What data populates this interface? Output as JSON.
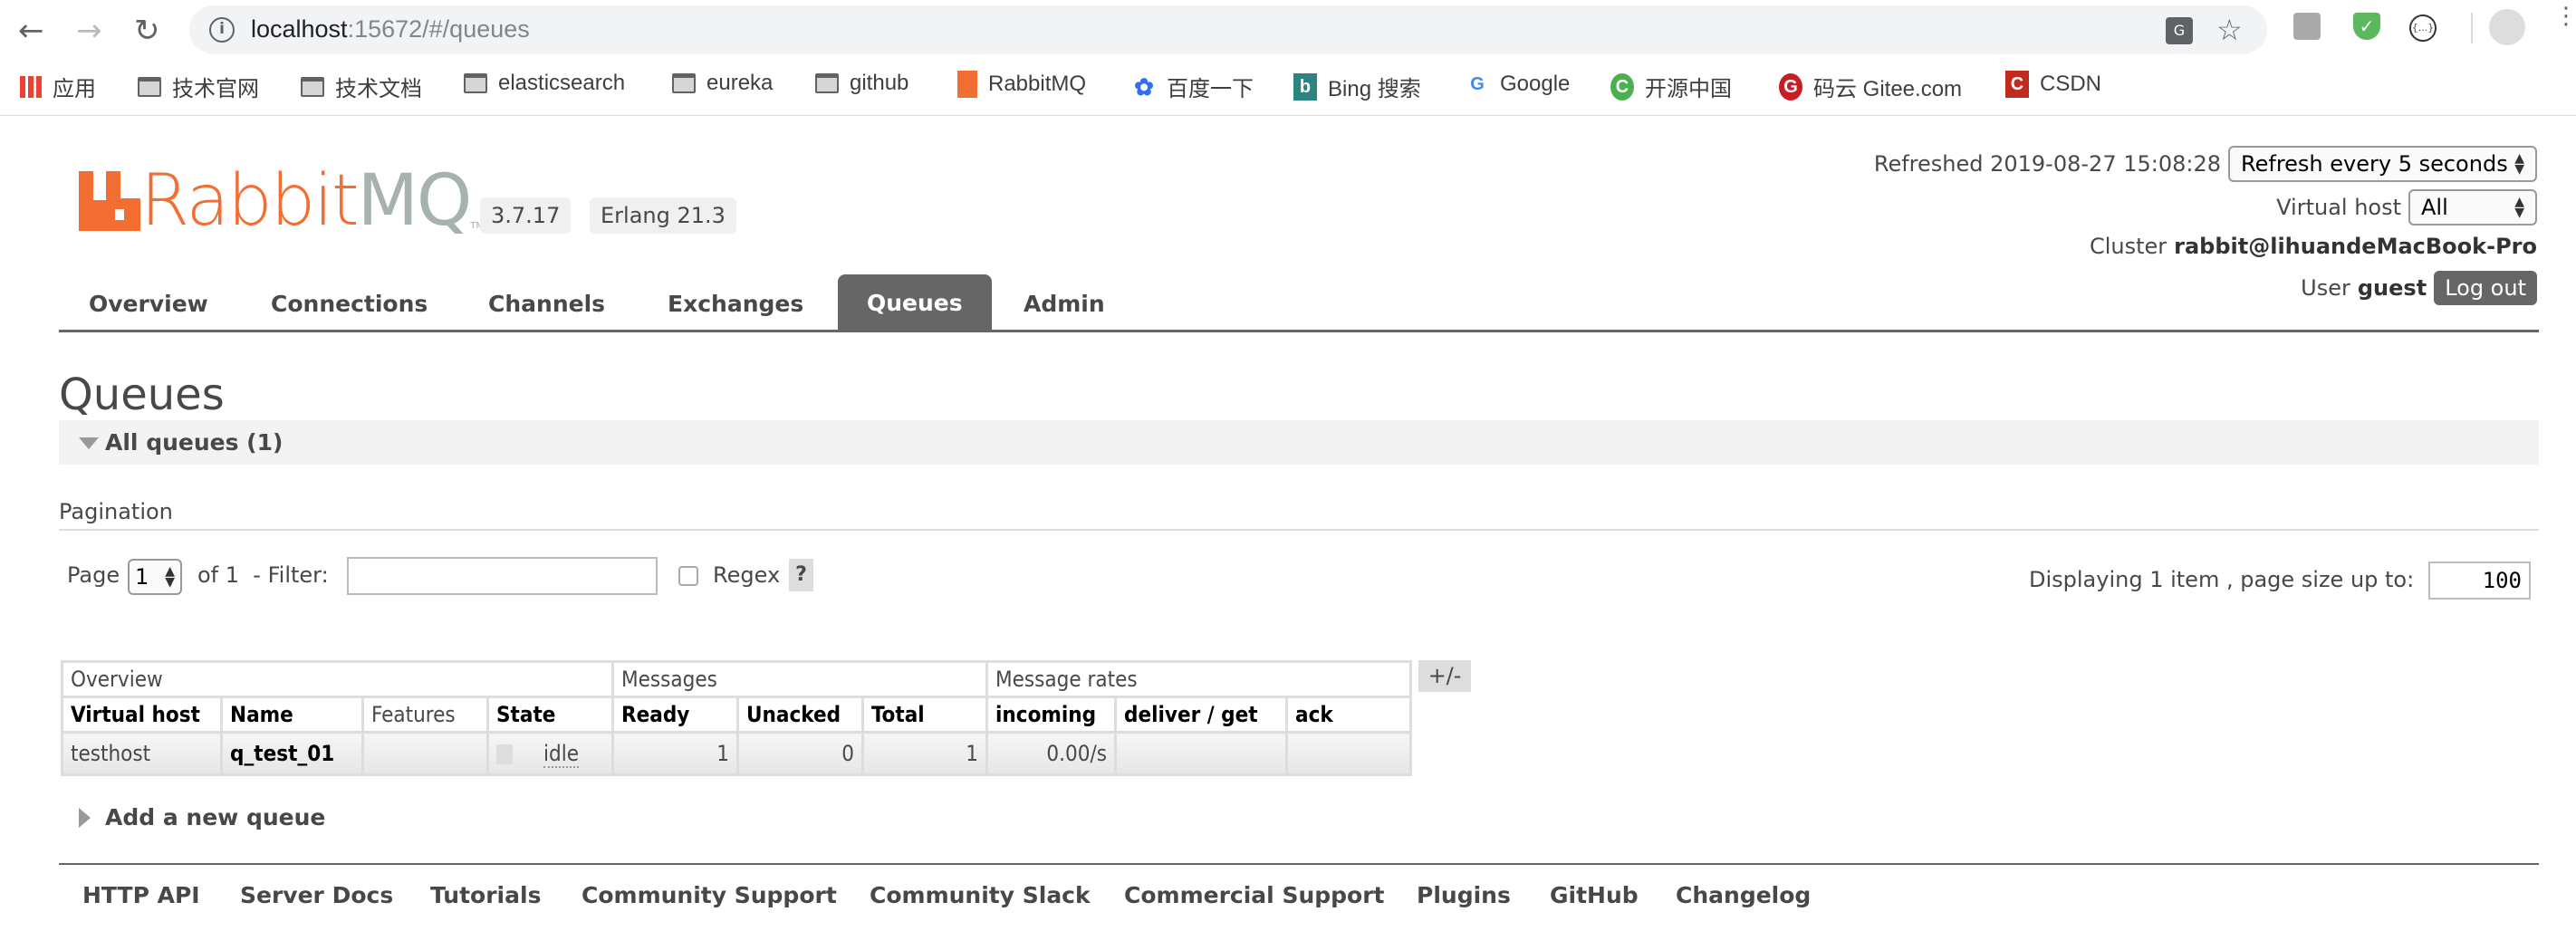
{
  "browser": {
    "url_host": "localhost",
    "url_rest": ":15672/#/queues",
    "bookmarks": [
      {
        "label": "应用",
        "icon": "apps-grid-icon"
      },
      {
        "label": "技术官网",
        "icon": "folder-icon"
      },
      {
        "label": "技术文档",
        "icon": "folder-icon"
      },
      {
        "label": "elasticsearch",
        "icon": "folder-icon"
      },
      {
        "label": "eureka",
        "icon": "folder-icon"
      },
      {
        "label": "github",
        "icon": "folder-icon"
      },
      {
        "label": "RabbitMQ",
        "icon": "rabbitmq-icon"
      },
      {
        "label": "百度一下",
        "icon": "baidu-icon"
      },
      {
        "label": "Bing 搜索",
        "icon": "bing-icon"
      },
      {
        "label": "Google",
        "icon": "google-icon"
      },
      {
        "label": "开源中国",
        "icon": "oschina-icon"
      },
      {
        "label": "码云 Gitee.com",
        "icon": "gitee-icon"
      },
      {
        "label": "CSDN",
        "icon": "csdn-icon"
      }
    ]
  },
  "header": {
    "logo_text_a": "Rabbit",
    "logo_text_b": "MQ",
    "logo_tm": "TM",
    "version": "3.7.17",
    "erlang": "Erlang 21.3",
    "refreshed": "Refreshed 2019-08-27 15:08:28",
    "refresh_option": "Refresh every 5 seconds",
    "vhost_label": "Virtual host",
    "vhost_option": "All",
    "cluster_label": "Cluster",
    "cluster_name": "rabbit@lihuandeMacBook-Pro",
    "user_label": "User",
    "user_name": "guest",
    "logout": "Log out"
  },
  "tabs": [
    "Overview",
    "Connections",
    "Channels",
    "Exchanges",
    "Queues",
    "Admin"
  ],
  "active_tab": "Queues",
  "page": {
    "title": "Queues",
    "section_title": "All queues (1)",
    "pagination_label": "Pagination",
    "page_label": "Page",
    "page_value": "1",
    "of_label": "of 1",
    "filter_label": "- Filter:",
    "filter_value": "",
    "regex_label": "Regex",
    "help": "?",
    "displaying": "Displaying 1 item , page size up to:",
    "page_size": "100"
  },
  "table": {
    "groups": [
      "Overview",
      "Messages",
      "Message rates"
    ],
    "columns": [
      "Virtual host",
      "Name",
      "Features",
      "State",
      "Ready",
      "Unacked",
      "Total",
      "incoming",
      "deliver / get",
      "ack"
    ],
    "rows": [
      {
        "vhost": "testhost",
        "name": "q_test_01",
        "features": "",
        "state": "idle",
        "ready": "1",
        "unacked": "0",
        "total": "1",
        "incoming": "0.00/s",
        "deliver_get": "",
        "ack": ""
      }
    ],
    "toggle": "+/-"
  },
  "add_queue": "Add a new queue",
  "footer": [
    "HTTP API",
    "Server Docs",
    "Tutorials",
    "Community Support",
    "Community Slack",
    "Commercial Support",
    "Plugins",
    "GitHub",
    "Changelog"
  ],
  "colors": {
    "brand_orange": "#f26e33",
    "brand_gray": "#a6b2af",
    "tab_active": "#666666"
  }
}
